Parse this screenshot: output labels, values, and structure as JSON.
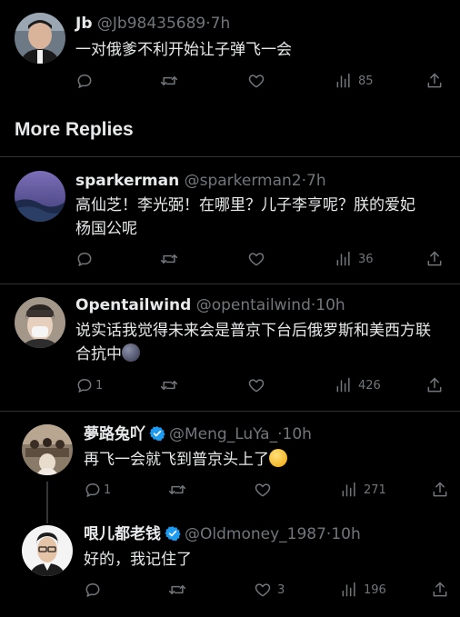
{
  "tweets": [
    {
      "name": "Jb",
      "handle": "@Jb98435689",
      "time": "7h",
      "text": "一对俄爹不利开始让子弹飞一会",
      "replies": "",
      "views": "85"
    },
    {
      "name": "sparkerman",
      "handle": "@sparkerman2",
      "time": "7h",
      "text": "高仙芝！李光弼！在哪里？儿子李亨呢？朕的爱妃 杨国公呢",
      "replies": "",
      "views": "36"
    },
    {
      "name": "Opentailwind",
      "handle": "@opentailwind",
      "time": "10h",
      "text": "说实话我觉得未来会是普京下台后俄罗斯和美西方联合抗中",
      "emoji": "new-moon-face",
      "replies": "1",
      "views": "426"
    },
    {
      "name": "夢路兔吖",
      "handle": "@Meng_LuYa_",
      "time": "10h",
      "text": "再飞一会就飞到普京头上了",
      "emoji": "rolling-on-floor-laughing",
      "replies": "1",
      "views": "271",
      "verified": true
    },
    {
      "name": "哏儿都老钱",
      "handle": "@Oldmoney_1987",
      "time": "10h",
      "text": "好的，我记住了",
      "replies": "",
      "likes": "3",
      "views": "196",
      "verified": true
    }
  ],
  "section": {
    "more_replies": "More Replies"
  },
  "dot": "·",
  "colors": {
    "background": "#000000",
    "text": "#e7e9ea",
    "secondary": "#71767b",
    "verified": "#1d9bf0",
    "divider": "#2f3336"
  },
  "icons": [
    "reply-icon",
    "retweet-icon",
    "like-icon",
    "views-icon",
    "share-icon",
    "verified-icon"
  ]
}
